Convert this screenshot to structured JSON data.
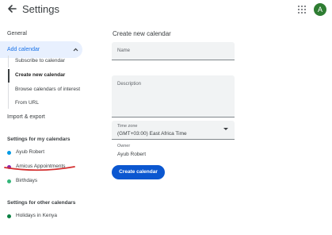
{
  "header": {
    "title": "Settings",
    "avatar_letter": "A",
    "back_icon": "arrow-left-icon",
    "apps_icon": "apps-grid-icon"
  },
  "sidebar": {
    "general": "General",
    "add_calendar": "Add calendar",
    "sub_items": [
      "Subscribe to calendar",
      "Create new calendar",
      "Browse calendars of interest",
      "From URL"
    ],
    "import_export": "Import & export",
    "my_calendars_heading": "Settings for my calendars",
    "my_calendars": [
      {
        "label": "Ayub Robert",
        "color": "#039be5"
      },
      {
        "label": "Amicus Appointments",
        "color": "#8e24aa"
      },
      {
        "label": "Birthdays",
        "color": "#33b679"
      }
    ],
    "other_calendars_heading": "Settings for other calendars",
    "other_calendars": [
      {
        "label": "Holidays in Kenya",
        "color": "#0b8043"
      }
    ]
  },
  "main": {
    "title": "Create new calendar",
    "name_label": "Name",
    "description_label": "Description",
    "timezone_label": "Time zone",
    "timezone_value": "(GMT+03:00) East Africa Time",
    "owner_label": "Owner",
    "owner_value": "Ayub Robert",
    "create_button": "Create calendar"
  },
  "colors": {
    "accent": "#1a73e8",
    "button": "#0b57d0",
    "active_bg": "#e8f0fe",
    "annotation_underline": "#d32f2f"
  }
}
